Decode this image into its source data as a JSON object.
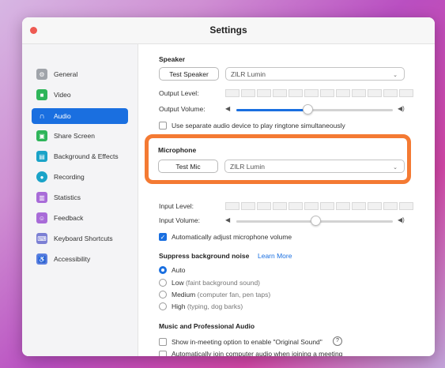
{
  "window": {
    "title": "Settings"
  },
  "sidebar": {
    "items": [
      {
        "label": "General",
        "icon": "gear-icon",
        "color": "#9aa0a6",
        "active": false
      },
      {
        "label": "Video",
        "icon": "video-camera-icon",
        "color": "#2fb55a",
        "active": false
      },
      {
        "label": "Audio",
        "icon": "headphones-icon",
        "color": "#1a6fe0",
        "active": true
      },
      {
        "label": "Share Screen",
        "icon": "share-screen-icon",
        "color": "#2fb55a",
        "active": false
      },
      {
        "label": "Background & Effects",
        "icon": "background-icon",
        "color": "#1aa3c8",
        "active": false
      },
      {
        "label": "Recording",
        "icon": "recording-icon",
        "color": "#1aa3c8",
        "active": false
      },
      {
        "label": "Statistics",
        "icon": "statistics-icon",
        "color": "#a86bd8",
        "active": false
      },
      {
        "label": "Feedback",
        "icon": "feedback-icon",
        "color": "#a86bd8",
        "active": false
      },
      {
        "label": "Keyboard Shortcuts",
        "icon": "keyboard-icon",
        "color": "#7b7fd4",
        "active": false
      },
      {
        "label": "Accessibility",
        "icon": "accessibility-icon",
        "color": "#5b7fe0",
        "active": false
      }
    ]
  },
  "speaker": {
    "heading": "Speaker",
    "test_button": "Test Speaker",
    "device": "ZILR Lumin",
    "output_level_label": "Output Level:",
    "output_volume_label": "Output Volume:",
    "output_volume_value": 0.45,
    "separate_device_label": "Use separate audio device to play ringtone simultaneously",
    "separate_device_checked": false
  },
  "microphone": {
    "heading": "Microphone",
    "test_button": "Test Mic",
    "device": "ZILR Lumin",
    "input_level_label": "Input Level:",
    "input_volume_label": "Input Volume:",
    "input_volume_value": 0.5,
    "auto_adjust_label": "Automatically adjust microphone volume",
    "auto_adjust_checked": true
  },
  "noise": {
    "heading": "Suppress background noise",
    "learn_more": "Learn More",
    "options": [
      {
        "label": "Auto",
        "hint": "",
        "checked": true
      },
      {
        "label": "Low",
        "hint": "(faint background sound)",
        "checked": false
      },
      {
        "label": "Medium",
        "hint": "(computer fan, pen taps)",
        "checked": false
      },
      {
        "label": "High",
        "hint": "(typing, dog barks)",
        "checked": false
      }
    ]
  },
  "music": {
    "heading": "Music and Professional Audio",
    "original_sound_label": "Show in-meeting option to enable \"Original Sound\"",
    "original_sound_checked": false
  },
  "join": {
    "auto_join_label": "Automatically join computer audio when joining a meeting",
    "auto_join_checked": false
  },
  "colors": {
    "accent": "#1a6fe0",
    "highlight": "#f47a33"
  }
}
